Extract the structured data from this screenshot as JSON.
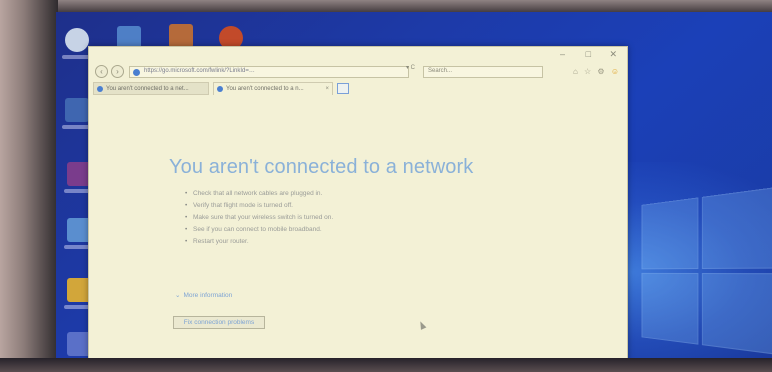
{
  "browser": {
    "window_controls": [
      "–",
      "□",
      "✕"
    ],
    "address_url": "https://go.microsoft.com/fwlink/?LinkId=…",
    "address_tools": "▾ C",
    "search_placeholder": "Search...",
    "toolbar_icons": [
      "⌂",
      "☆",
      "⚙"
    ],
    "smiley": "☺",
    "tabs": [
      {
        "label": "You aren't connected to a net...",
        "active": false
      },
      {
        "label": "You aren't connected to a n...",
        "active": true
      }
    ],
    "tab_close": "×"
  },
  "error_page": {
    "title": "You aren't connected to a network",
    "bullets": [
      "Check that all network cables are plugged in.",
      "Verify that flight mode is turned off.",
      "Make sure that your wireless switch is turned on.",
      "See if you can connect to mobile broadband.",
      "Restart your router."
    ],
    "more_info": "More information",
    "more_info_chevron": "⌄",
    "fix_button": "Fix connection problems"
  },
  "colors": {
    "page_background": "#f3f1d6",
    "title_blue": "#8ab1d8",
    "link_blue": "#7ea4d4",
    "desktop_blue": "#1d3aa8"
  }
}
